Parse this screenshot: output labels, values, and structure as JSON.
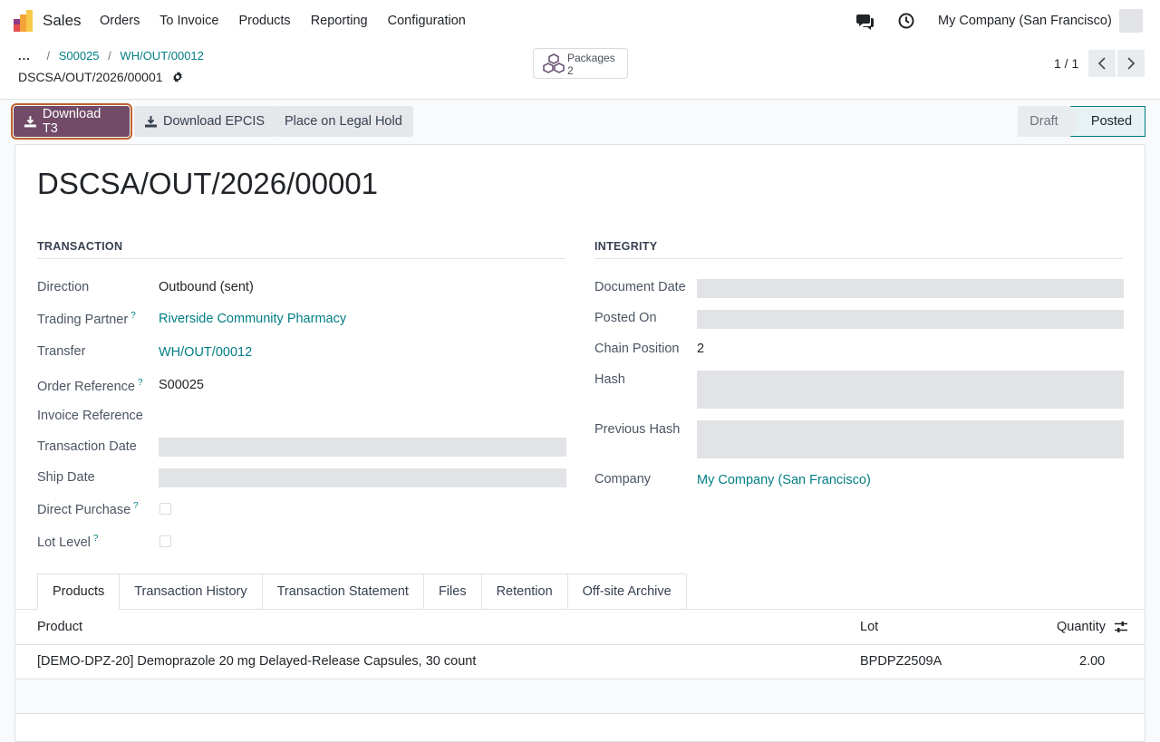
{
  "navbar": {
    "app_name": "Sales",
    "menu": [
      "Orders",
      "To Invoice",
      "Products",
      "Reporting",
      "Configuration"
    ],
    "company": "My Company (San Francisco)",
    "icons": [
      "chat-icon",
      "clock-icon"
    ]
  },
  "breadcrumb": {
    "ellipsis": "...",
    "items": [
      "S00025",
      "WH/OUT/00012"
    ],
    "current": "DSCSA/OUT/2026/00001"
  },
  "smart_button": {
    "label": "Packages",
    "count": "2"
  },
  "pager": {
    "value": "1 / 1"
  },
  "actions": {
    "download_t3": "Download T3",
    "download_epcis": "Download EPCIS",
    "legal_hold": "Place on Legal Hold"
  },
  "status": {
    "stages": [
      "Draft",
      "Posted"
    ],
    "current": "Posted"
  },
  "form": {
    "title": "DSCSA/OUT/2026/00001",
    "transaction": {
      "heading": "TRANSACTION",
      "direction_label": "Direction",
      "direction": "Outbound (sent)",
      "partner_label": "Trading Partner",
      "partner": "Riverside Community Pharmacy",
      "transfer_label": "Transfer",
      "transfer": "WH/OUT/00012",
      "order_ref_label": "Order Reference",
      "order_ref": "S00025",
      "invoice_ref_label": "Invoice Reference",
      "txn_date_label": "Transaction Date",
      "ship_date_label": "Ship Date",
      "direct_purchase_label": "Direct Purchase",
      "lot_level_label": "Lot Level",
      "help_mark": "?"
    },
    "integrity": {
      "heading": "INTEGRITY",
      "doc_date_label": "Document Date",
      "posted_on_label": "Posted On",
      "chain_pos_label": "Chain Position",
      "chain_pos": "2",
      "hash_label": "Hash",
      "prev_hash_label": "Previous Hash",
      "company_label": "Company",
      "company": "My Company (San Francisco)"
    }
  },
  "tabs": [
    "Products",
    "Transaction History",
    "Transaction Statement",
    "Files",
    "Retention",
    "Off-site Archive"
  ],
  "table": {
    "headers": {
      "product": "Product",
      "lot": "Lot",
      "quantity": "Quantity"
    },
    "rows": [
      {
        "product": "[DEMO-DPZ-20] Demoprazole 20 mg Delayed-Release Capsules, 30 count",
        "lot": "BPDPZ2509A",
        "quantity": "2.00"
      }
    ]
  },
  "colors": {
    "brand": "#714b67",
    "link": "#017e84",
    "focus": "#c0622b"
  }
}
